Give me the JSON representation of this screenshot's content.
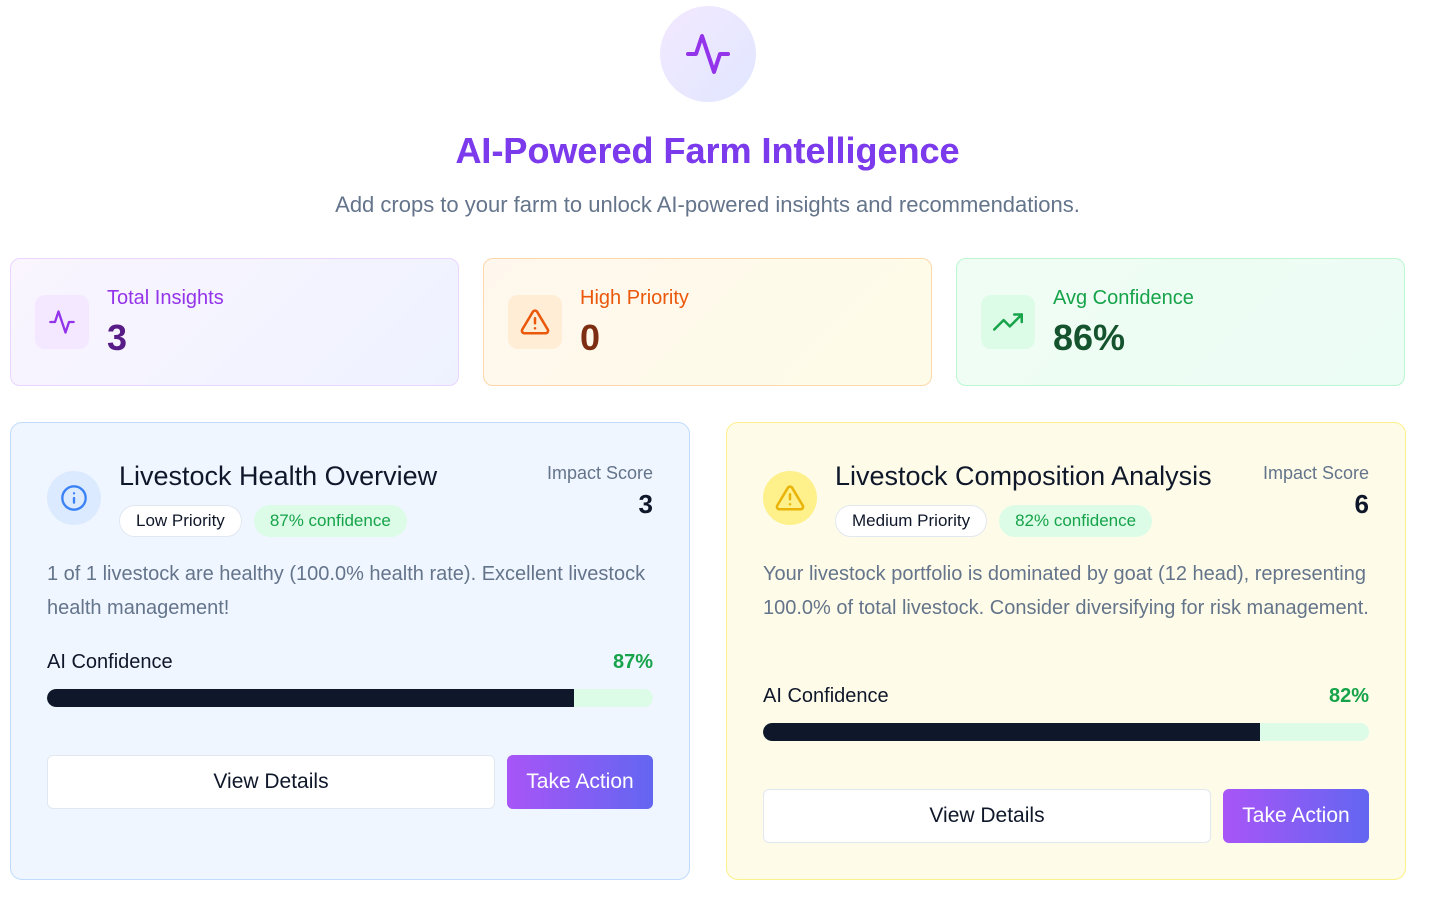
{
  "hero": {
    "icon": "activity-icon",
    "title": "AI-Powered Farm Intelligence",
    "subtitle": "Add crops to your farm to unlock AI-powered insights and recommendations."
  },
  "stats": [
    {
      "label": "Total Insights",
      "value": "3",
      "icon": "activity-icon",
      "color": "#9333ea"
    },
    {
      "label": "High Priority",
      "value": "0",
      "icon": "alert-triangle-icon",
      "color": "#ea580c"
    },
    {
      "label": "Avg Confidence",
      "value": "86%",
      "icon": "trending-up-icon",
      "color": "#16a34a"
    }
  ],
  "insights": [
    {
      "title": "Livestock Health Overview",
      "icon": "info-icon",
      "priority": "Low Priority",
      "confidence_badge": "87% confidence",
      "impact_label": "Impact Score",
      "impact_value": "3",
      "description": "1 of 1 livestock are healthy (100.0% health rate). Excellent livestock health management!",
      "confidence_label": "AI Confidence",
      "confidence_pct": "87%",
      "confidence_value": 0.87,
      "view_label": "View Details",
      "action_label": "Take Action",
      "accent": "#3b82f6"
    },
    {
      "title": "Livestock Composition Analysis",
      "icon": "alert-triangle-icon",
      "priority": "Medium Priority",
      "confidence_badge": "82% confidence",
      "impact_label": "Impact Score",
      "impact_value": "6",
      "description": "Your livestock portfolio is dominated by goat (12 head), representing 100.0% of total livestock. Consider diversifying for risk management.",
      "confidence_label": "AI Confidence",
      "confidence_pct": "82%",
      "confidence_value": 0.82,
      "view_label": "View Details",
      "action_label": "Take Action",
      "accent": "#eab308"
    }
  ]
}
